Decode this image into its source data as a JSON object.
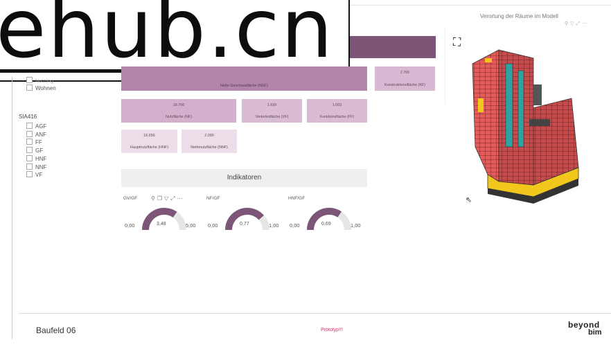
{
  "watermark": {
    "text": "ehub.cn"
  },
  "filters": {
    "partial_item": "Nutzung",
    "wohnen": "Wohnen",
    "group_title": "SIA416",
    "items": [
      "AGF",
      "ANF",
      "FF",
      "GF",
      "HNF",
      "NNF",
      "VF"
    ]
  },
  "tiles": {
    "ngf": {
      "label": "Netto Geschossfläche (NGF)"
    },
    "kf": {
      "value": "2.766",
      "label": "Konstruktionsfläche (KF)"
    },
    "nf": {
      "value": "18.766",
      "label": "Nutzfläche (NF)"
    },
    "vf": {
      "value": "1.699",
      "label": "Verkehrsfläche (VF)"
    },
    "ff": {
      "value": "1.003",
      "label": "Funktionsfläche (FF)"
    },
    "hnf": {
      "value": "16.656",
      "label": "Hauptnutzfläche (HNF)"
    },
    "nnf": {
      "value": "2.090",
      "label": "Nettonutzfläche (NNF)"
    }
  },
  "indicators": {
    "title": "Indikatoren",
    "gauges": [
      {
        "label": "GV/GF",
        "min": "0,00",
        "max": "5,00",
        "value": "3,48",
        "fraction": 0.696
      },
      {
        "label": "NF/GF",
        "min": "0,00",
        "max": "1,00",
        "value": "0,77",
        "fraction": 0.77
      },
      {
        "label": "HNF/GF",
        "min": "0,00",
        "max": "1,00",
        "value": "0,69",
        "fraction": 0.69
      }
    ],
    "toolbar_icons": [
      "pin-icon",
      "copy-icon",
      "filter-icon",
      "expand-icon",
      "more-icon"
    ]
  },
  "viz": {
    "title": "Verortung der Räume im Modell",
    "icons": [
      "pin-icon",
      "filter-icon",
      "expand-icon",
      "more-icon"
    ]
  },
  "footer": {
    "title": "Baufeld 06",
    "middle": "Prototyp!!!",
    "logo_line1": "beyond",
    "logo_line2": "bim"
  },
  "colors": {
    "accent": "#7d5577",
    "gauge_fill": "#7d5577",
    "gauge_track": "#e6e6e6",
    "building_red": "#e85a5a",
    "building_yellow": "#f2c71b",
    "building_teal": "#2fa3a0"
  }
}
